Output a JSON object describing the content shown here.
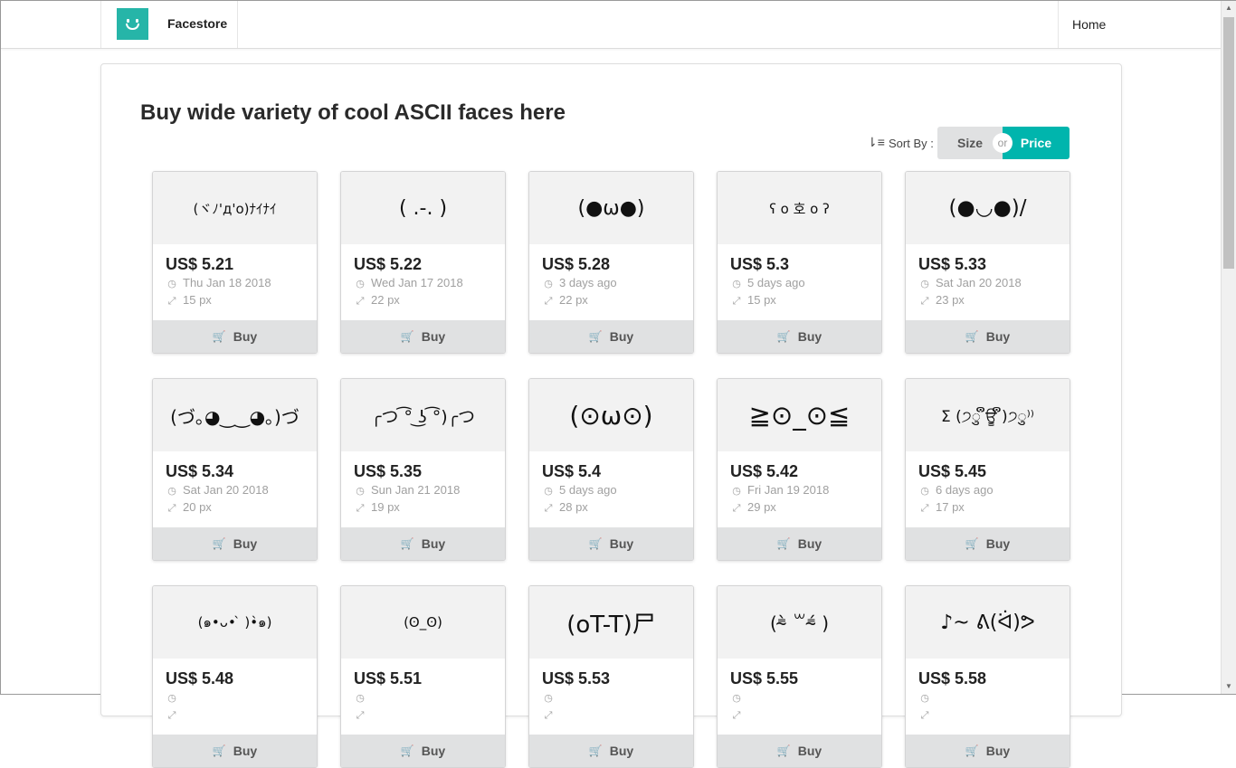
{
  "nav": {
    "brand": "Facestore",
    "home": "Home"
  },
  "page": {
    "heading": "Buy wide variety of cool ASCII faces here"
  },
  "sort": {
    "label": "Sort By :",
    "size": "Size",
    "or": "or",
    "price": "Price",
    "active": "Price"
  },
  "buy_label": "Buy",
  "products": [
    {
      "face": "(ヾﾉ'д'o)ﾅｲﾅｲ",
      "price": "US$ 5.21",
      "date": "Thu Jan 18 2018",
      "size": "15 px"
    },
    {
      "face": "( .-. )",
      "price": "US$ 5.22",
      "date": "Wed Jan 17 2018",
      "size": "22 px"
    },
    {
      "face": "(●ω●)",
      "price": "US$ 5.28",
      "date": "3 days ago",
      "size": "22 px"
    },
    {
      "face": "ʕ o 호 o ʔ",
      "price": "US$ 5.3",
      "date": "5 days ago",
      "size": "15 px"
    },
    {
      "face": "(●◡●)/",
      "price": "US$ 5.33",
      "date": "Sat Jan 20 2018",
      "size": "23 px"
    },
    {
      "face": "(づ｡◕‿‿◕｡)づ",
      "price": "US$ 5.34",
      "date": "Sat Jan 20 2018",
      "size": "20 px"
    },
    {
      "face": "╭つ ͡° ͜ʖ ͡°)╭つ",
      "price": "US$ 5.35",
      "date": "Sun Jan 21 2018",
      "size": "19 px"
    },
    {
      "face": "(⊙ω⊙)",
      "price": "US$ 5.4",
      "date": "5 days ago",
      "size": "28 px"
    },
    {
      "face": "≧⊙_⊙≦",
      "price": "US$ 5.42",
      "date": "Fri Jan 19 2018",
      "size": "29 px"
    },
    {
      "face": "Σ (੭ु ຶਊ ຶ)੭ु⁾⁾",
      "price": "US$ 5.45",
      "date": "6 days ago",
      "size": "17 px"
    },
    {
      "face": "(๑•ᴗ• ̀ )•̀๑)",
      "price": "US$ 5.48",
      "date": "",
      "size": ""
    },
    {
      "face": "(ʘ_ʘ)",
      "price": "US$ 5.51",
      "date": "",
      "size": ""
    },
    {
      "face": "(oT-T)尸",
      "price": "US$ 5.53",
      "date": "",
      "size": ""
    },
    {
      "face": "(⁼̴̀ ꒳⁼̴́ )",
      "price": "US$ 5.55",
      "date": "",
      "size": ""
    },
    {
      "face": "♪~ ᕕ(ᐛ)ᕗ",
      "price": "US$ 5.58",
      "date": "",
      "size": ""
    }
  ]
}
